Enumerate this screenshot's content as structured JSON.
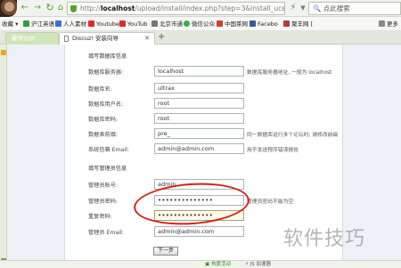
{
  "browser": {
    "url_prefix": "http://",
    "url_host": "localhost",
    "url_path": "/upload/install/index.php?step=3&install_ucenter=",
    "search_placeholder": "点此搜索"
  },
  "bookmarks": [
    {
      "label": "收藏",
      "color": "#e9a23b"
    },
    {
      "label": "沪江英语",
      "color": "#2f9e3f"
    },
    {
      "label": "人人素材",
      "color": "#3b6fcf"
    },
    {
      "label": "Youtube",
      "color": "#e22828"
    },
    {
      "label": "YouTub",
      "color": "#e22828"
    },
    {
      "label": "北京市通",
      "color": "#777777"
    },
    {
      "label": "微信公众",
      "color": "#36b24a"
    },
    {
      "label": "中国茶网",
      "color": "#d0402a"
    },
    {
      "label": "Facebo",
      "color": "#3b5998"
    },
    {
      "label": "聚丰网 [",
      "color": "#b33b3b"
    },
    {
      "label": "更多",
      "color": "#888888"
    }
  ],
  "tabs": [
    {
      "label": "最常访问"
    },
    {
      "label": "Discuz! 安装向导"
    }
  ],
  "db_section": {
    "title": "填写数据库信息",
    "fields": [
      {
        "label": "数据库服务器:",
        "value": "localhost",
        "hint": "数据库服务器地址, 一般为 localhost"
      },
      {
        "label": "数据库名:",
        "value": "ultrax",
        "hint": ""
      },
      {
        "label": "数据库用户名:",
        "value": "root",
        "hint": ""
      },
      {
        "label": "数据库密码:",
        "value": "root",
        "hint": ""
      },
      {
        "label": "数据表前缀:",
        "value": "pre_",
        "hint": "同一数据库运行多个论坛时, 请修改前缀"
      },
      {
        "label": "系统信箱 Email:",
        "value": "admin@admin.com",
        "hint": "用于发送程序错误报告"
      }
    ]
  },
  "admin_section": {
    "title": "填写管理员信息",
    "fields": [
      {
        "label": "管理员账号:",
        "value": "admin",
        "hint": ""
      },
      {
        "label": "管理员密码:",
        "value": "••••••••••••••",
        "hint": "管理员密码不能为空"
      },
      {
        "label": "重复密码:",
        "value": "••••••••••••••",
        "hint": ""
      },
      {
        "label": "管理员 Email:",
        "value": "admin@admin.com",
        "hint": ""
      }
    ]
  },
  "next_button": "下一步",
  "status_bar": [
    "热度活动",
    "JS 加速器"
  ],
  "watermark": "软件技巧"
}
